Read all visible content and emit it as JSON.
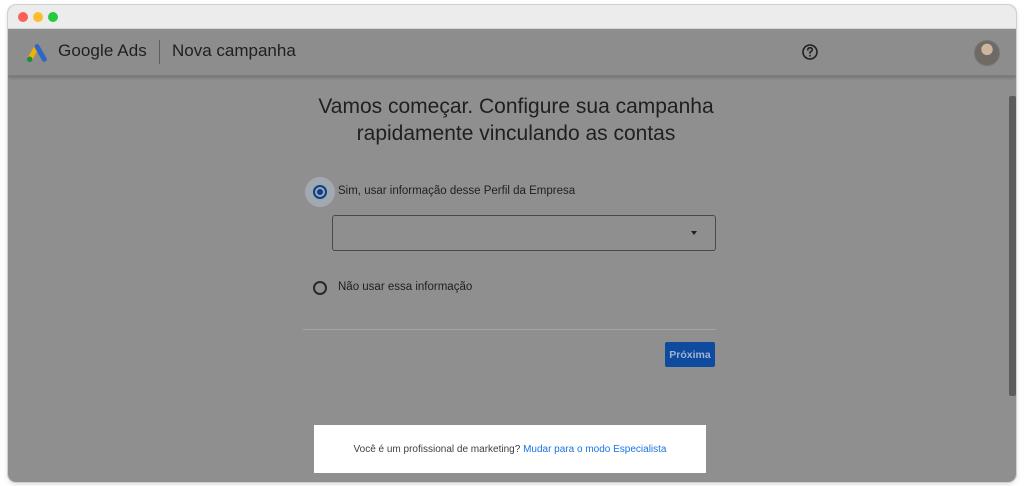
{
  "header": {
    "brand": "Google Ads",
    "title": "Nova campanha"
  },
  "main": {
    "heading": "Vamos começar. Configure sua campanha rapidamente vinculando as contas",
    "option_yes": "Sim, usar informação desse Perfil da Empresa",
    "option_no": "Não usar essa informação",
    "select_value": "",
    "next_label": "Próxima"
  },
  "footer": {
    "prompt": "Você é um profissional de marketing?",
    "link": "Mudar para o modo Especialista"
  },
  "colors": {
    "primary": "#0e4a9e",
    "link": "#1a73e8"
  },
  "icons": [
    "google-ads-logo-icon",
    "help-icon",
    "chevron-down-icon"
  ]
}
